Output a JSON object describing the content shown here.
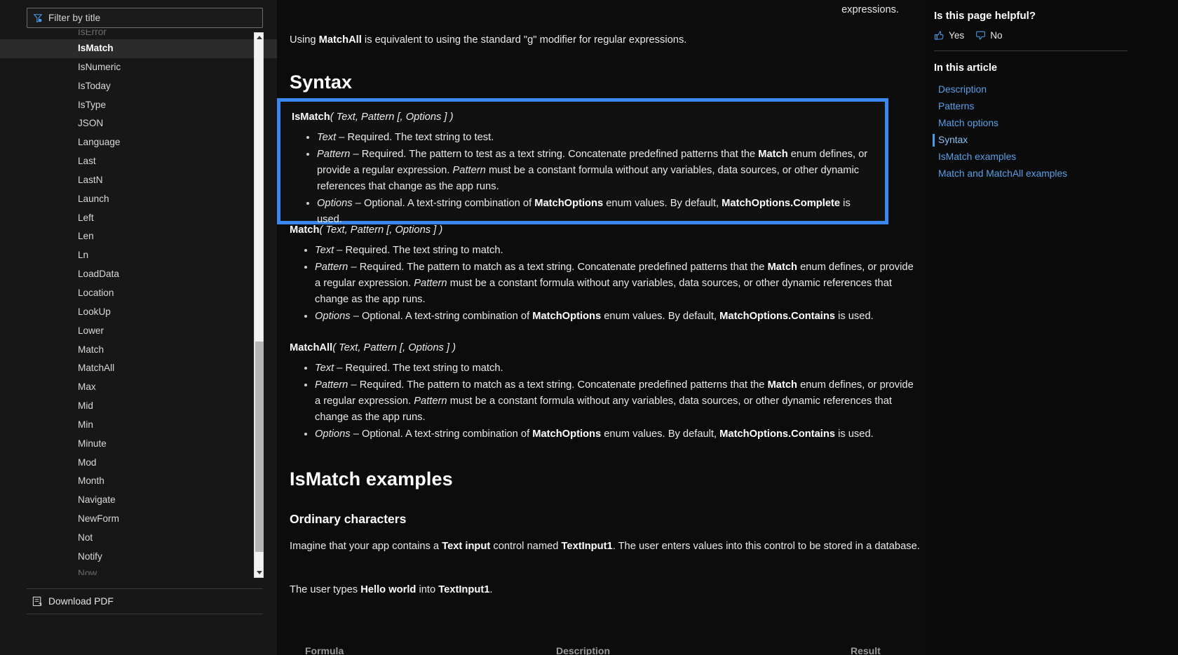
{
  "app": {
    "accent_blue": "#3b87f0",
    "link_blue": "#5aa0e8",
    "bg": "#0b0b0b",
    "sidebar_bg": "#171717"
  },
  "sidebar": {
    "filter": {
      "placeholder": "Filter by title",
      "value": "Filter by title",
      "icon": "filter-icon"
    },
    "partial_top_item": "IsError",
    "items": [
      {
        "label": "IsMatch",
        "selected": true
      },
      {
        "label": "IsNumeric",
        "selected": false
      },
      {
        "label": "IsToday",
        "selected": false
      },
      {
        "label": "IsType",
        "selected": false
      },
      {
        "label": "JSON",
        "selected": false
      },
      {
        "label": "Language",
        "selected": false
      },
      {
        "label": "Last",
        "selected": false
      },
      {
        "label": "LastN",
        "selected": false
      },
      {
        "label": "Launch",
        "selected": false
      },
      {
        "label": "Left",
        "selected": false
      },
      {
        "label": "Len",
        "selected": false
      },
      {
        "label": "Ln",
        "selected": false
      },
      {
        "label": "LoadData",
        "selected": false
      },
      {
        "label": "Location",
        "selected": false
      },
      {
        "label": "LookUp",
        "selected": false
      },
      {
        "label": "Lower",
        "selected": false
      },
      {
        "label": "Match",
        "selected": false
      },
      {
        "label": "MatchAll",
        "selected": false
      },
      {
        "label": "Max",
        "selected": false
      },
      {
        "label": "Mid",
        "selected": false
      },
      {
        "label": "Min",
        "selected": false
      },
      {
        "label": "Minute",
        "selected": false
      },
      {
        "label": "Mod",
        "selected": false
      },
      {
        "label": "Month",
        "selected": false
      },
      {
        "label": "Navigate",
        "selected": false
      },
      {
        "label": "NewForm",
        "selected": false
      },
      {
        "label": "Not",
        "selected": false
      },
      {
        "label": "Notify",
        "selected": false
      }
    ],
    "partial_bottom_item": "Now",
    "download_pdf": {
      "label": "Download PDF",
      "icon": "pdf-icon"
    }
  },
  "main": {
    "fragment_above": "expressions.",
    "intro": {
      "pre": "Using ",
      "bold": "MatchAll",
      "post": " is equivalent to using the standard \"g\" modifier for regular expressions."
    },
    "syntax_heading": "Syntax",
    "signatures": [
      {
        "name": "IsMatch",
        "sig_rest": "( Text, Pattern [, Options ] )",
        "highlighted": true,
        "args": [
          {
            "term": "Text",
            "text": " – Required. The text string to test."
          },
          {
            "term": "Pattern",
            "text_a": " – Required. The pattern to test as a text string. Concatenate predefined patterns that the ",
            "bold_a": "Match",
            "text_b": " enum defines, or provide a regular expression. ",
            "italic_b": "Pattern",
            "text_c": " must be a constant formula without any variables, data sources, or other dynamic references that change as the app runs."
          },
          {
            "term": "Options",
            "text_a": " – Optional. A text-string combination of ",
            "bold_a": "MatchOptions",
            "text_b": " enum values. By default, ",
            "bold_b": "MatchOptions.Complete",
            "text_c": " is used."
          }
        ]
      },
      {
        "name": "Match",
        "sig_rest": "( Text, Pattern [, Options ] )",
        "highlighted": false,
        "args": [
          {
            "term": "Text",
            "text": " – Required. The text string to match."
          },
          {
            "term": "Pattern",
            "text_a": " – Required. The pattern to match as a text string. Concatenate predefined patterns that the ",
            "bold_a": "Match",
            "text_b": " enum defines, or provide a regular expression. ",
            "italic_b": "Pattern",
            "text_c": " must be a constant formula without any variables, data sources, or other dynamic references that change as the app runs."
          },
          {
            "term": "Options",
            "text_a": " – Optional. A text-string combination of ",
            "bold_a": "MatchOptions",
            "text_b": " enum values. By default, ",
            "bold_b": "MatchOptions.Contains",
            "text_c": " is used."
          }
        ]
      },
      {
        "name": "MatchAll",
        "sig_rest": "( Text, Pattern [, Options ] )",
        "highlighted": false,
        "args": [
          {
            "term": "Text",
            "text": " – Required. The text string to match."
          },
          {
            "term": "Pattern",
            "text_a": " – Required. The pattern to match as a text string. Concatenate predefined patterns that the ",
            "bold_a": "Match",
            "text_b": " enum defines, or provide a regular expression. ",
            "italic_b": "Pattern",
            "text_c": " must be a constant formula without any variables, data sources, or other dynamic references that change as the app runs."
          },
          {
            "term": "Options",
            "text_a": " – Optional. A text-string combination of ",
            "bold_a": "MatchOptions",
            "text_b": " enum values. By default, ",
            "bold_b": "MatchOptions.Contains",
            "text_c": " is used."
          }
        ]
      }
    ],
    "examples_heading": "IsMatch examples",
    "ordinary_heading": "Ordinary characters",
    "ordinary_p1": {
      "a": "Imagine that your app contains a ",
      "b1": "Text input",
      "b": " control named ",
      "b2": "TextInput1",
      "c": ". The user enters values into this control to be stored in a database."
    },
    "ordinary_p2": {
      "a": "The user types ",
      "b1": "Hello world",
      "b": " into ",
      "b2": "TextInput1",
      "c": "."
    },
    "table_headers": [
      "Formula",
      "Description",
      "Result"
    ]
  },
  "right_rail": {
    "helpful_title": "Is this page helpful?",
    "yes_label": "Yes",
    "no_label": "No",
    "in_this_article": "In this article",
    "links": [
      {
        "label": "Description",
        "active": false
      },
      {
        "label": "Patterns",
        "active": false
      },
      {
        "label": "Match options",
        "active": false
      },
      {
        "label": "Syntax",
        "active": true
      },
      {
        "label": "IsMatch examples",
        "active": false
      },
      {
        "label": "Match and MatchAll examples",
        "active": false
      }
    ]
  }
}
